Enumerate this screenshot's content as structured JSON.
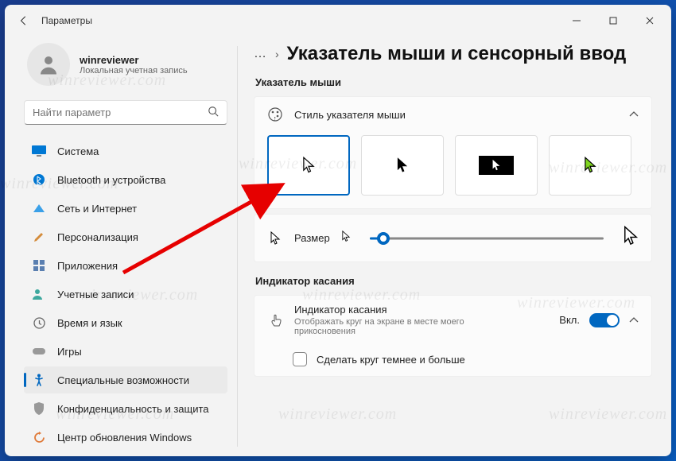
{
  "titlebar": {
    "title": "Параметры"
  },
  "profile": {
    "name": "winreviewer",
    "sub": "Локальная учетная запись"
  },
  "search": {
    "placeholder": "Найти параметр"
  },
  "nav": [
    {
      "label": "Система"
    },
    {
      "label": "Bluetooth и устройства"
    },
    {
      "label": "Сеть и Интернет"
    },
    {
      "label": "Персонализация"
    },
    {
      "label": "Приложения"
    },
    {
      "label": "Учетные записи"
    },
    {
      "label": "Время и язык"
    },
    {
      "label": "Игры"
    },
    {
      "label": "Специальные возможности"
    },
    {
      "label": "Конфиденциальность и защита"
    },
    {
      "label": "Центр обновления Windows"
    }
  ],
  "page": {
    "title": "Указатель мыши и сенсорный ввод",
    "section1": "Указатель мыши",
    "style_card": "Стиль указателя мыши",
    "size_label": "Размер",
    "section2": "Индикатор касания",
    "touch_title": "Индикатор касания",
    "touch_sub": "Отображать круг на экране в месте моего прикосновения",
    "toggle_state": "Вкл.",
    "darker": "Сделать круг темнее и больше"
  },
  "watermark": "winreviewer.com"
}
